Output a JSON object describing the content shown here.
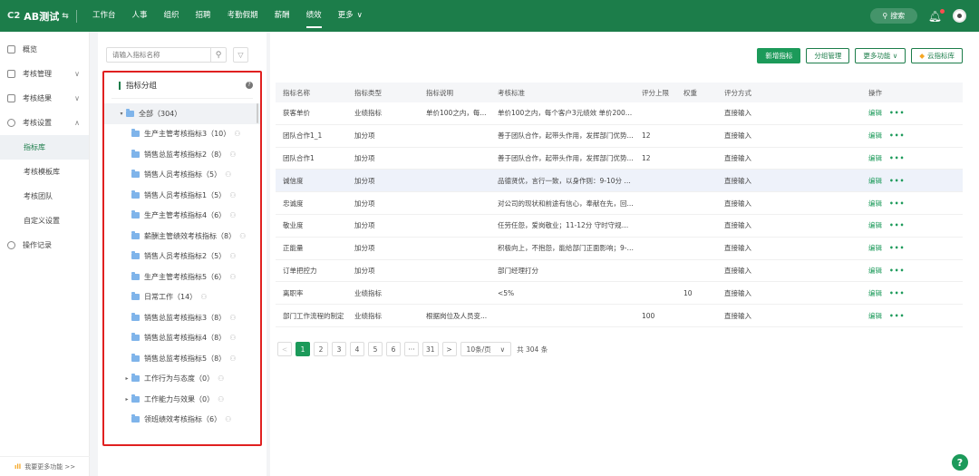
{
  "topbar": {
    "brand": "AB测试",
    "nav": [
      "工作台",
      "人事",
      "组织",
      "招聘",
      "考勤假期",
      "薪酬",
      "绩效",
      "更多"
    ],
    "active_index": 6,
    "more_arrow": "∨",
    "search_label": "搜索"
  },
  "sidebar": {
    "items": [
      {
        "label": "概览",
        "icon": "overview-icon"
      },
      {
        "label": "考核管理",
        "icon": "document-icon",
        "caret": "∨"
      },
      {
        "label": "考核结果",
        "icon": "result-icon",
        "caret": "∨"
      },
      {
        "label": "考核设置",
        "icon": "gear-icon",
        "caret": "∧"
      }
    ],
    "sub_items": [
      "指标库",
      "考核模板库",
      "考核团队",
      "自定义设置"
    ],
    "active_sub": 0,
    "record": "操作记录",
    "footer": "我要更多功能 >>"
  },
  "group_panel": {
    "search_placeholder": "请输入指标名称",
    "title": "指标分组",
    "root": "全部（304）",
    "items": [
      {
        "label": "生产主管考核指标3（10）",
        "expandable": false
      },
      {
        "label": "销售总监考核指标2（8）",
        "expandable": false
      },
      {
        "label": "销售人员考核指标（5）",
        "expandable": false
      },
      {
        "label": "销售人员考核指标1（5）",
        "expandable": false
      },
      {
        "label": "生产主管考核指标4（6）",
        "expandable": false
      },
      {
        "label": "薪酬主管绩效考核指标（8）",
        "expandable": false
      },
      {
        "label": "销售人员考核指标2（5）",
        "expandable": false
      },
      {
        "label": "生产主管考核指标5（6）",
        "expandable": false
      },
      {
        "label": "日常工作（14）",
        "expandable": false
      },
      {
        "label": "销售总监考核指标3（8）",
        "expandable": false
      },
      {
        "label": "销售总监考核指标4（8）",
        "expandable": false
      },
      {
        "label": "销售总监考核指标5（8）",
        "expandable": false
      },
      {
        "label": "工作行为与态度（0）",
        "expandable": true
      },
      {
        "label": "工作能力与效果（0）",
        "expandable": true
      },
      {
        "label": "领班绩效考核指标（6）",
        "expandable": false
      }
    ]
  },
  "toolbar": {
    "new": "新增指标",
    "group_manage": "分组管理",
    "more": "更多功能 ∨",
    "cloud": "云指标库"
  },
  "table": {
    "headers": [
      "指标名称",
      "指标类型",
      "指标说明",
      "考核标准",
      "评分上限",
      "权重",
      "评分方式",
      "操作"
    ],
    "rows": [
      [
        "获客单价",
        "业绩指标",
        "单价100之内，每...",
        "单价100之内，每个客户3元绩效 单价200之...",
        "",
        "",
        "直接输入"
      ],
      [
        "团队合作1_1",
        "加分项",
        "",
        "善于团队合作，起带头作用，发挥部门优势...",
        "12",
        "",
        "直接输入"
      ],
      [
        "团队合作1",
        "加分项",
        "",
        "善于团队合作，起带头作用，发挥部门优势...",
        "12",
        "",
        "直接输入"
      ],
      [
        "诚信度",
        "加分项",
        "",
        "品德贤优，言行一致，以身作则：9-10分 诚...",
        "",
        "",
        "直接输入"
      ],
      [
        "忠诚度",
        "加分项",
        "",
        "对公司的现状和前途有信心，奉献在先，回...",
        "",
        "",
        "直接输入"
      ],
      [
        "敬业度",
        "加分项",
        "",
        "任劳任怨，爱岗敬业；11-12分 守时守规，不...",
        "",
        "",
        "直接输入"
      ],
      [
        "正能量",
        "加分项",
        "",
        "积极向上，不抱怨，能给部门正面影响；9-1...",
        "",
        "",
        "直接输入"
      ],
      [
        "订单把控力",
        "加分项",
        "",
        "部门经理打分",
        "",
        "",
        "直接输入"
      ],
      [
        "离职率",
        "业绩指标",
        "",
        "<5%",
        "",
        "10",
        "直接输入"
      ],
      [
        "部门工作流程的制定",
        "业绩指标",
        "根据岗位及人员变...",
        "",
        "100",
        "",
        "直接输入"
      ]
    ],
    "highlight_row": 3,
    "edit_label": "编辑",
    "more_label": "•••"
  },
  "pager": {
    "prev": "<",
    "pages": [
      "1",
      "2",
      "3",
      "4",
      "5",
      "6",
      "···",
      "31"
    ],
    "active": 0,
    "next": ">",
    "size": "10条/页",
    "size_arrow": "∨",
    "total": "共 304 条"
  },
  "help": "?"
}
